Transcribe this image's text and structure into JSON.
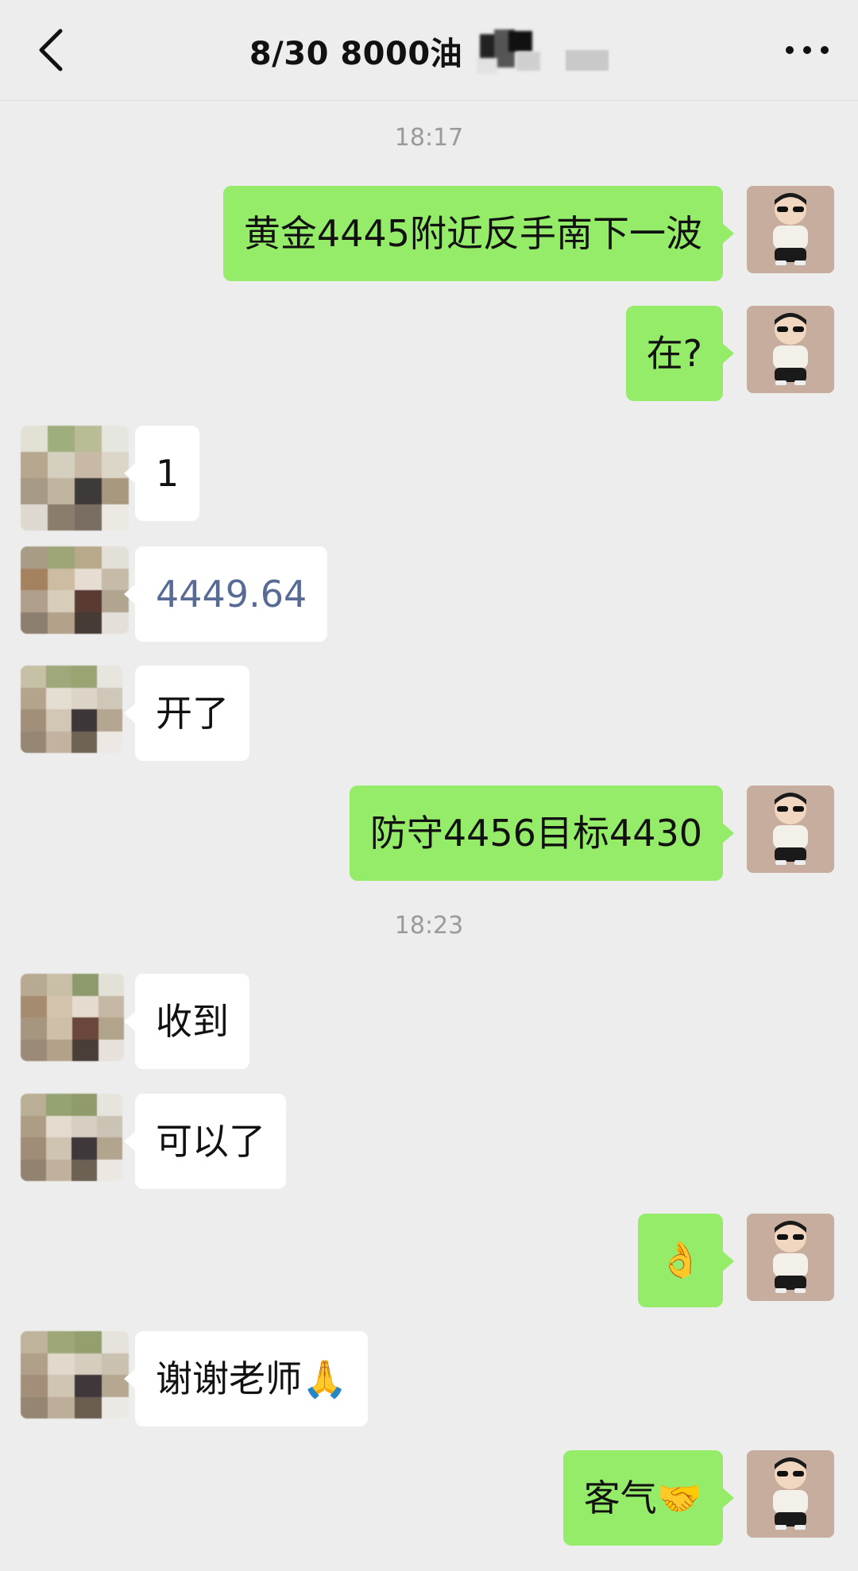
{
  "header": {
    "title": "8/30  8000油",
    "back_icon": "chevron-left-icon",
    "more_icon": "more-dots-icon"
  },
  "colors": {
    "background": "#ededed",
    "my_bubble": "#95ec69",
    "other_bubble": "#ffffff",
    "link": "#576b95",
    "timestamp": "#9a9a9a"
  },
  "chat": {
    "time1": "18:17",
    "time2": "18:23",
    "messages": [
      {
        "sender": "me",
        "text": "黄金4445附近反手南下一波"
      },
      {
        "sender": "me",
        "text": "在?"
      },
      {
        "sender": "other",
        "text": "1"
      },
      {
        "sender": "other",
        "text": "4449.64"
      },
      {
        "sender": "other",
        "text": "开了"
      },
      {
        "sender": "me",
        "text": "防守4456目标4430"
      },
      {
        "sender": "other",
        "text": "收到"
      },
      {
        "sender": "other",
        "text": "可以了"
      },
      {
        "sender": "me",
        "text": "👌"
      },
      {
        "sender": "other",
        "text": "谢谢老师🙏"
      },
      {
        "sender": "me",
        "text": "客气🤝"
      }
    ]
  }
}
